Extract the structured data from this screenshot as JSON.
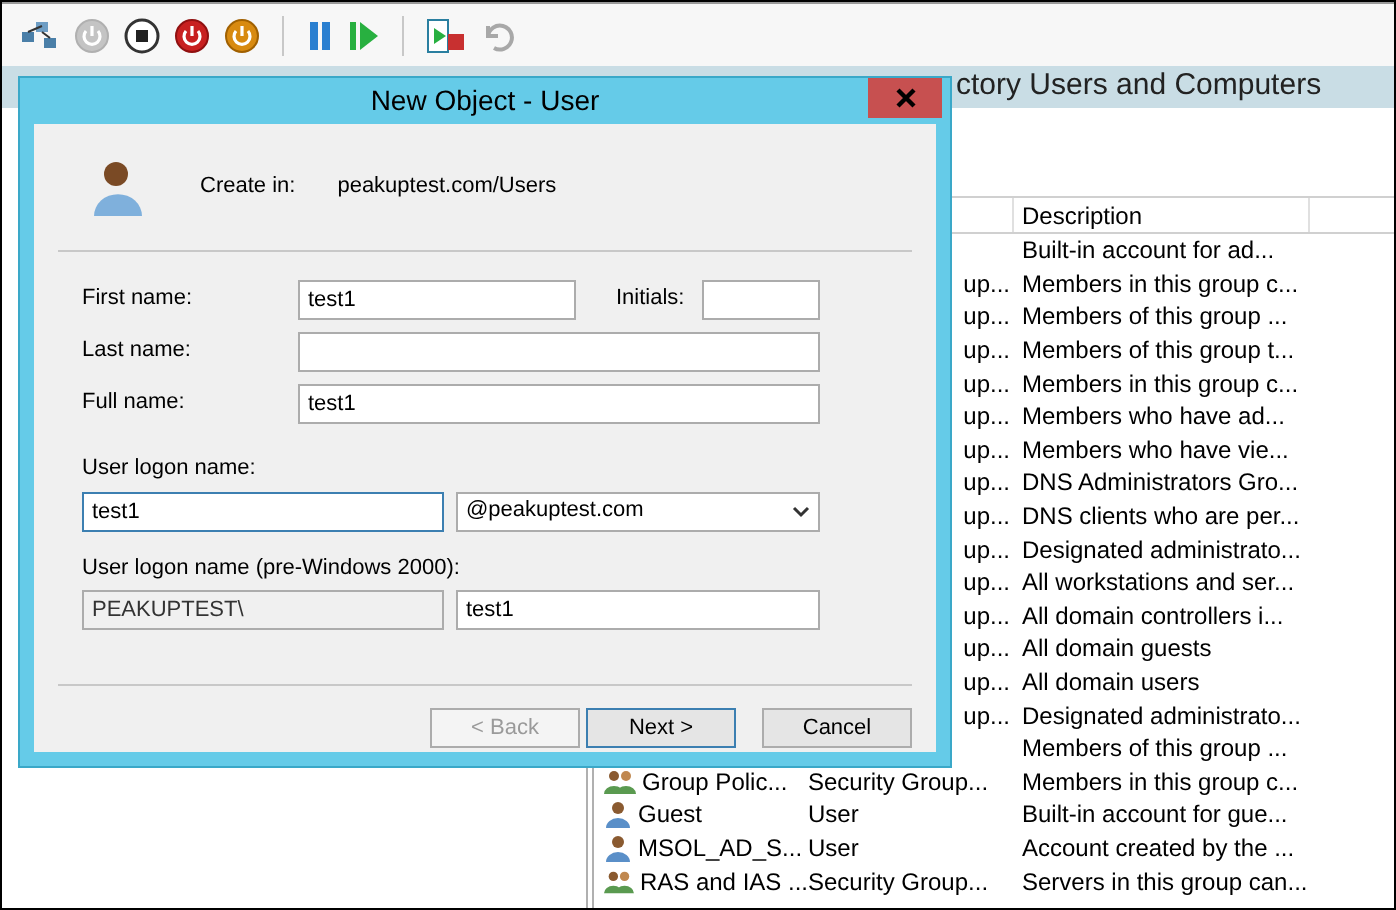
{
  "toolbar": [
    {
      "kind": "network"
    },
    {
      "kind": "power-gray"
    },
    {
      "kind": "stop"
    },
    {
      "kind": "power-red"
    },
    {
      "kind": "power-orange"
    },
    {
      "kind": "separator"
    },
    {
      "kind": "pause"
    },
    {
      "kind": "play"
    },
    {
      "kind": "separator"
    },
    {
      "kind": "connect"
    },
    {
      "kind": "undo"
    }
  ],
  "main_window": {
    "title": "ctory Users and Computers"
  },
  "list": {
    "columns": [
      "Description"
    ],
    "rows": [
      {
        "description": "Built-in account for ad..."
      },
      {
        "type": "up...",
        "description": "Members in this group c..."
      },
      {
        "type": "up...",
        "description": "Members of this group ..."
      },
      {
        "type": "up...",
        "description": "Members of this group t..."
      },
      {
        "type": "up...",
        "description": "Members in this group c..."
      },
      {
        "type": "up...",
        "description": "Members who have ad..."
      },
      {
        "type": "up...",
        "description": "Members who have vie..."
      },
      {
        "type": "up...",
        "description": "DNS Administrators Gro..."
      },
      {
        "type": "up...",
        "description": "DNS clients who are per..."
      },
      {
        "type": "up...",
        "description": "Designated administrato..."
      },
      {
        "type": "up...",
        "description": "All workstations and ser..."
      },
      {
        "type": "up...",
        "description": "All domain controllers i..."
      },
      {
        "type": "up...",
        "description": "All domain guests"
      },
      {
        "type": "up...",
        "description": "All domain users"
      },
      {
        "type": "up...",
        "description": "Designated administrato..."
      },
      {
        "description": "Members of this group ..."
      },
      {
        "kind": "group",
        "name": "Group Polic...",
        "type": "Security Group...",
        "description": "Members in this group c..."
      },
      {
        "kind": "user",
        "name": "Guest",
        "type": "User",
        "description": "Built-in account for gue..."
      },
      {
        "kind": "user",
        "name": "MSOL_AD_S...",
        "type": "User",
        "description": "Account created by the ..."
      },
      {
        "kind": "group",
        "name": "RAS and IAS ...",
        "type": "Security Group...",
        "description": "Servers in this group can..."
      }
    ]
  },
  "dialog": {
    "title": "New Object - User",
    "create_in_label": "Create in:",
    "create_in": "peakuptest.com/Users",
    "first_name": {
      "label": "First name:",
      "value": "test1"
    },
    "initials": {
      "label": "Initials:"
    },
    "last_name": {
      "label": "Last name:"
    },
    "full_name": {
      "label": "Full name:",
      "value": "test1"
    },
    "logon_name": {
      "label": "User logon name:",
      "value": "test1",
      "domain": "@peakuptest.com"
    },
    "pre2000": {
      "label": "User logon name (pre-Windows 2000):",
      "prefix": "PEAKUPTEST\\",
      "value": "test1"
    },
    "buttons": [
      {
        "label": "< Back",
        "disabled": true,
        "default": false
      },
      {
        "label": "Next >",
        "disabled": false,
        "default": true
      },
      {
        "label": "Cancel",
        "disabled": false,
        "default": false
      }
    ]
  }
}
